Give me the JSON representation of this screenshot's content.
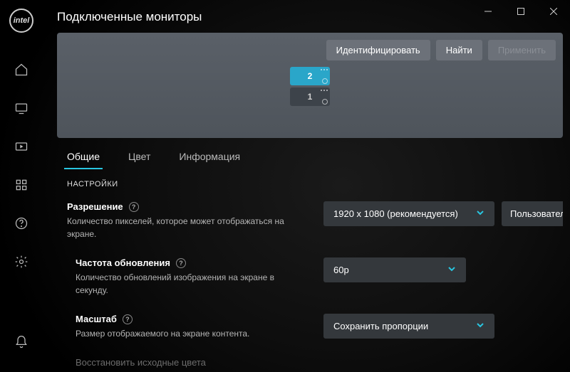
{
  "window": {
    "title": "Подключенные мониторы"
  },
  "rail": {
    "logo": "intel"
  },
  "panel": {
    "identify": "Идентифицировать",
    "find": "Найти",
    "apply": "Применить",
    "monitor2": "2",
    "monitor1": "1"
  },
  "tabs": {
    "general": "Общие",
    "color": "Цвет",
    "info": "Информация"
  },
  "settings": {
    "heading": "НАСТРОЙКИ",
    "resolution": {
      "title": "Разрешение",
      "desc": "Количество пикселей, которое может отображаться на экране.",
      "value": "1920 x 1080 (рекомендуется)",
      "custom": "Пользователь"
    },
    "refresh": {
      "title": "Частота обновления",
      "desc": "Количество обновлений изображения на экране в секунду.",
      "value": "60p"
    },
    "scale": {
      "title": "Масштаб",
      "desc": "Размер отображаемого на экране контента.",
      "value": "Сохранить пропорции"
    },
    "restore": "Восстановить исходные цвета"
  }
}
